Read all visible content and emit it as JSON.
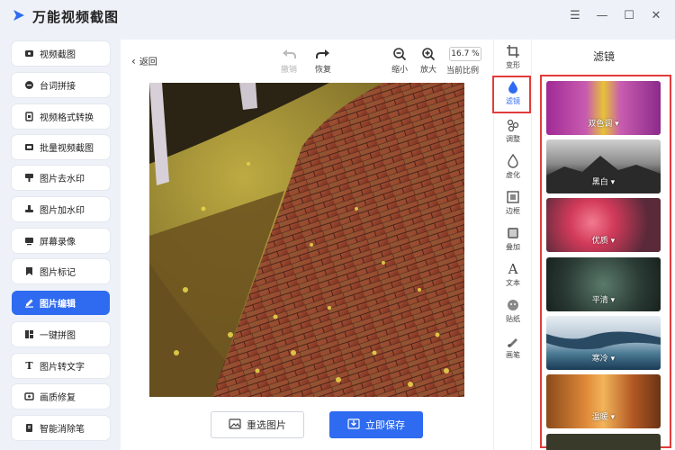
{
  "app": {
    "title": "万能视频截图"
  },
  "window_controls": [
    "menu-icon",
    "minimize-icon",
    "maximize-icon",
    "close-icon"
  ],
  "sidebar": {
    "items": [
      {
        "label": "视频截图",
        "icon": "video-icon"
      },
      {
        "label": "台词拼接",
        "icon": "subtitle-icon"
      },
      {
        "label": "视频格式转换",
        "icon": "convert-icon"
      },
      {
        "label": "批量视频截图",
        "icon": "batch-icon"
      },
      {
        "label": "图片去水印",
        "icon": "remove-watermark-icon"
      },
      {
        "label": "图片加水印",
        "icon": "add-watermark-icon"
      },
      {
        "label": "屏幕录像",
        "icon": "record-icon"
      },
      {
        "label": "图片标记",
        "icon": "mark-icon"
      },
      {
        "label": "图片编辑",
        "icon": "edit-icon",
        "active": true
      },
      {
        "label": "一键拼图",
        "icon": "collage-icon"
      },
      {
        "label": "图片转文字",
        "icon": "text-icon"
      },
      {
        "label": "画质修复",
        "icon": "repair-icon"
      },
      {
        "label": "智能消除笔",
        "icon": "eraser-icon"
      }
    ]
  },
  "editor": {
    "back_label": "返回",
    "undo_label": "撤销",
    "redo_label": "恢复",
    "zoom_out_label": "缩小",
    "zoom_in_label": "放大",
    "zoom_value": "16.7 %",
    "zoom_caption": "当前比例",
    "reselect_label": "重选图片",
    "save_label": "立即保存"
  },
  "tools": [
    {
      "label": "变形",
      "icon": "crop-icon"
    },
    {
      "label": "滤镜",
      "icon": "filter-icon",
      "active": true
    },
    {
      "label": "调整",
      "icon": "adjust-icon"
    },
    {
      "label": "虚化",
      "icon": "blur-icon"
    },
    {
      "label": "边框",
      "icon": "border-icon"
    },
    {
      "label": "叠加",
      "icon": "overlay-icon"
    },
    {
      "label": "文本",
      "icon": "text-tool-icon"
    },
    {
      "label": "贴纸",
      "icon": "sticker-icon"
    },
    {
      "label": "画笔",
      "icon": "brush-icon"
    }
  ],
  "filters": {
    "title": "滤镜",
    "items": [
      {
        "label": "双色调"
      },
      {
        "label": "黑白"
      },
      {
        "label": "优质"
      },
      {
        "label": "平清"
      },
      {
        "label": "寒冷"
      },
      {
        "label": "温暖"
      }
    ]
  },
  "colors": {
    "accent": "#2f6bf0",
    "highlight": "#e23b3b"
  }
}
